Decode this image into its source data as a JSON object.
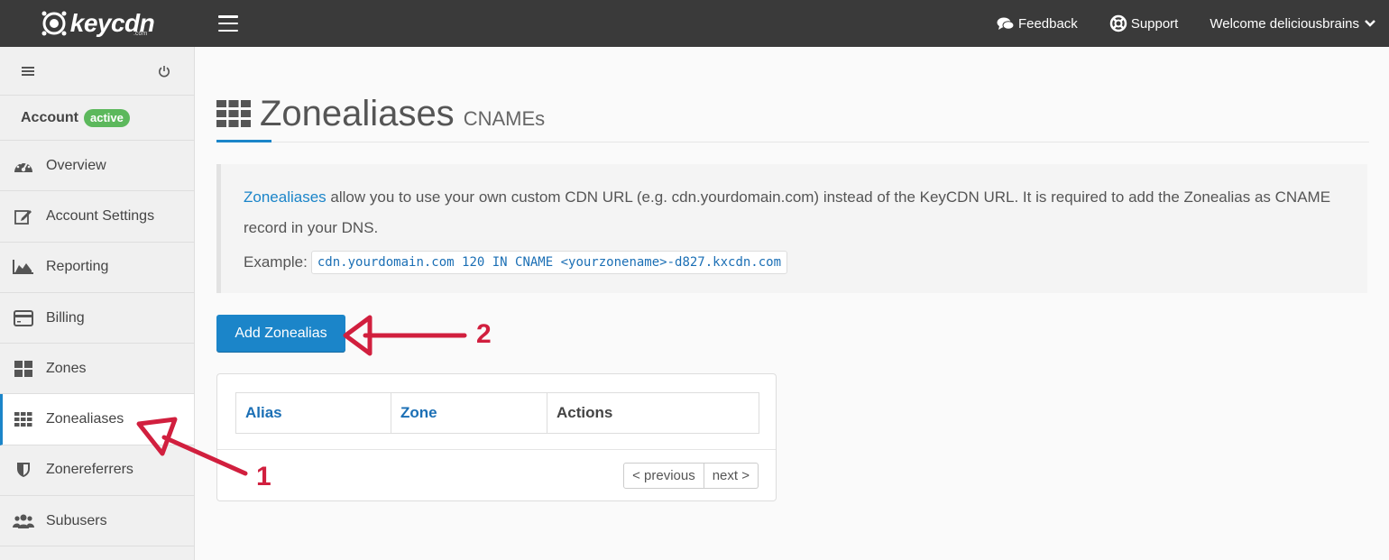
{
  "app": {
    "logo_text": "keycdn",
    "logo_suffix": ".com"
  },
  "topbar": {
    "feedback_label": "Feedback",
    "support_label": "Support",
    "welcome_label": "Welcome deliciousbrains"
  },
  "sidebar": {
    "account_label": "Account",
    "account_status": "active",
    "items": [
      {
        "label": "Overview",
        "icon": "dashboard-icon"
      },
      {
        "label": "Account Settings",
        "icon": "edit-icon"
      },
      {
        "label": "Reporting",
        "icon": "area-chart-icon"
      },
      {
        "label": "Billing",
        "icon": "credit-card-icon"
      },
      {
        "label": "Zones",
        "icon": "zones-grid-icon"
      },
      {
        "label": "Zonealiases",
        "icon": "zonealiases-grid-icon",
        "active": true
      },
      {
        "label": "Zonereferrers",
        "icon": "shield-icon"
      },
      {
        "label": "Subusers",
        "icon": "users-icon"
      }
    ]
  },
  "page": {
    "title": "Zonealiases",
    "subtitle": "CNAMEs"
  },
  "info": {
    "link_text": "Zonealiases",
    "text_rest": " allow you to use your own custom CDN URL (e.g. cdn.yourdomain.com) instead of the KeyCDN URL. It is required to add the Zonealias as CNAME record in your DNS.",
    "example_label": "Example:",
    "example_code": "cdn.yourdomain.com 120 IN CNAME <yourzonename>-d827.kxcdn.com"
  },
  "actions": {
    "add_label": "Add Zonealias"
  },
  "table": {
    "columns": [
      "Alias",
      "Zone",
      "Actions"
    ]
  },
  "pagination": {
    "previous_label": "< previous",
    "next_label": "next >"
  },
  "annotations": {
    "marker_1": "1",
    "marker_2": "2"
  },
  "colors": {
    "accent": "#1b85c9",
    "topbar": "#3a3a3a",
    "badge": "#5cb85c",
    "annotation": "#d11f3e"
  }
}
